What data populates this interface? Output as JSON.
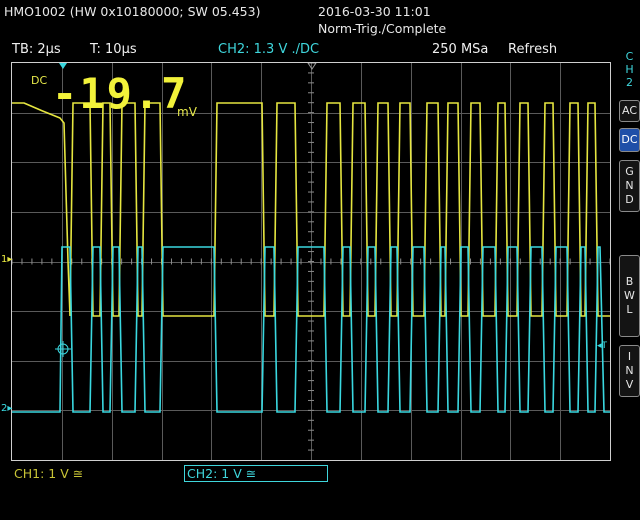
{
  "header": {
    "device": "HMO1002 (HW 0x10180000; SW 05.453)",
    "datetime": "2016-03-30 11:01",
    "trigger_status": "Norm-Trig./Complete",
    "timebase": "TB: 2µs",
    "trigger_time": "T: 10µs",
    "channel_info": "CH2: 1.3 V ./DC",
    "sample_rate": "250 MSa",
    "acquisition_mode": "Refresh"
  },
  "measurement": {
    "coupling": "DC",
    "value": "-19.7",
    "unit": "mV"
  },
  "markers": {
    "ch1_level": "1",
    "ch2_level": "2",
    "trigger_marker": "T"
  },
  "side_menu": {
    "channel_label": [
      "C",
      "H",
      "2"
    ],
    "buttons": [
      {
        "lines": [
          "AC"
        ],
        "active": false
      },
      {
        "lines": [
          "DC"
        ],
        "active": true
      },
      {
        "lines": [
          "G",
          "N",
          "D"
        ],
        "active": false
      },
      {
        "lines": [
          "B",
          "W",
          "L"
        ],
        "active": false
      },
      {
        "lines": [
          "I",
          "N",
          "V"
        ],
        "active": false
      }
    ]
  },
  "footer": {
    "ch1_scale": "CH1: 1 V ≅",
    "ch2_scale": "CH2: 1 V ≅"
  },
  "colors": {
    "ch1": "#e6e640",
    "ch2": "#3ad8e0",
    "grid": "#5a5a5a",
    "border": "#cfcfcf",
    "active_button": "#1f4fa8"
  }
}
